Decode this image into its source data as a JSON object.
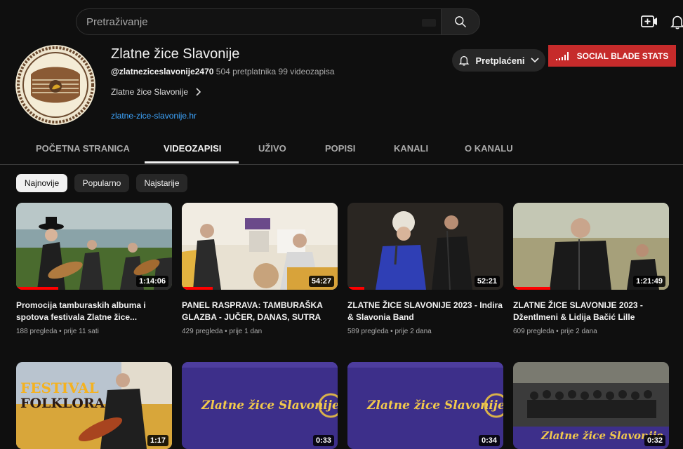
{
  "search": {
    "placeholder": "Pretraživanje"
  },
  "channel": {
    "name": "Zlatne žice Slavonije",
    "handle": "@zlatneziceslavonije2470",
    "subscribers": "504 pretplatnika",
    "video_count": "99 videozapisa",
    "description": "Zlatne žice Slavonije",
    "link": "zlatne-zice-slavonije.hr"
  },
  "buttons": {
    "subscribed": "Pretplaćeni",
    "social_blade": "SOCIAL BLADE STATS"
  },
  "tabs": [
    {
      "label": "POČETNA STRANICA"
    },
    {
      "label": "VIDEOZAPISI"
    },
    {
      "label": "UŽIVO"
    },
    {
      "label": "POPISI"
    },
    {
      "label": "KANALI"
    },
    {
      "label": "O KANALU"
    }
  ],
  "chips": [
    {
      "label": "Najnovije"
    },
    {
      "label": "Popularno"
    },
    {
      "label": "Najstarije"
    }
  ],
  "videos": [
    {
      "title": "Promocija tamburaskih albuma i spotova festivala Zlatne žice...",
      "views": "188 pregleda",
      "age": "prije 11 sati",
      "duration": "1:14:06",
      "progress": 0.27
    },
    {
      "title": "PANEL RASPRAVA: TAMBURAŠKA GLAZBA - JUČER, DANAS, SUTRA",
      "views": "429 pregleda",
      "age": "prije 1 dan",
      "duration": "54:27",
      "progress": 0.2
    },
    {
      "title": "ZLATNE ŽICE SLAVONIJE 2023 - Indira & Slavonia Band",
      "views": "589 pregleda",
      "age": "prije 2 dana",
      "duration": "52:21",
      "progress": 0.11
    },
    {
      "title": "ZLATNE ŽICE SLAVONIJE 2023 - Džentlmeni & Lidija Bačić Lille",
      "views": "609 pregleda",
      "age": "prije 2 dana",
      "duration": "1:21:49",
      "progress": 0.24
    },
    {
      "title": "",
      "views": "",
      "age": "",
      "duration": "1:17",
      "thumb_text": [
        "FESTIVAL",
        "FOLKLORA"
      ]
    },
    {
      "title": "",
      "views": "",
      "age": "",
      "duration": "0:33",
      "thumb_text": [
        "Zlatne žice Slavonije"
      ]
    },
    {
      "title": "",
      "views": "",
      "age": "",
      "duration": "0:34",
      "thumb_text": [
        "Zlatne žice Slavonije"
      ]
    },
    {
      "title": "",
      "views": "",
      "age": "",
      "duration": "0:32",
      "thumb_text": [
        "Zlatne žice Slavonije"
      ]
    }
  ],
  "colors": {
    "background": "#0f0f0f",
    "accent_link": "#3ea6ff",
    "social_blade": "#c62b2b",
    "progress": "#ff0000"
  }
}
